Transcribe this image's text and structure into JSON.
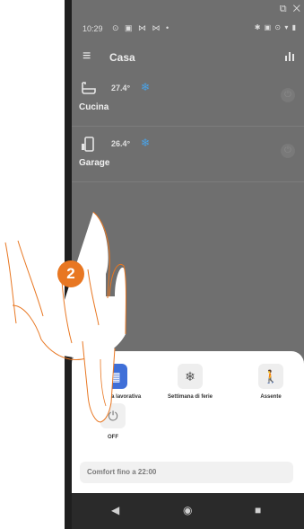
{
  "status_bar": {
    "time": "10:29",
    "left_icons": "⊙ ▣ ⋈ ⋈ •",
    "right_icons": "✱ ▣ ⊙ ▾ ▮"
  },
  "corner_icons": "⧉ ✕",
  "app_bar": {
    "title": "Casa"
  },
  "rooms": [
    {
      "name": "Cucina",
      "temperature": "27.4°",
      "icon": "bathtub-icon"
    },
    {
      "name": "Garage",
      "temperature": "26.4°",
      "icon": "thermostat-icon"
    }
  ],
  "bottom_sheet": {
    "modes": [
      {
        "label": "Settimana lavorativa",
        "icon": "calendar-icon",
        "active": true
      },
      {
        "label": "Settimana di ferie",
        "icon": "snowflake-icon",
        "active": false
      },
      {
        "label": "Assente",
        "icon": "walking-person-icon",
        "active": false
      }
    ],
    "off_label": "OFF",
    "comfort_text": "Comfort fino a 22:00"
  },
  "step_badge": "2",
  "colors": {
    "accent": "#3f6fd8",
    "badge": "#e87722",
    "snowflake": "#4aa3e8"
  }
}
